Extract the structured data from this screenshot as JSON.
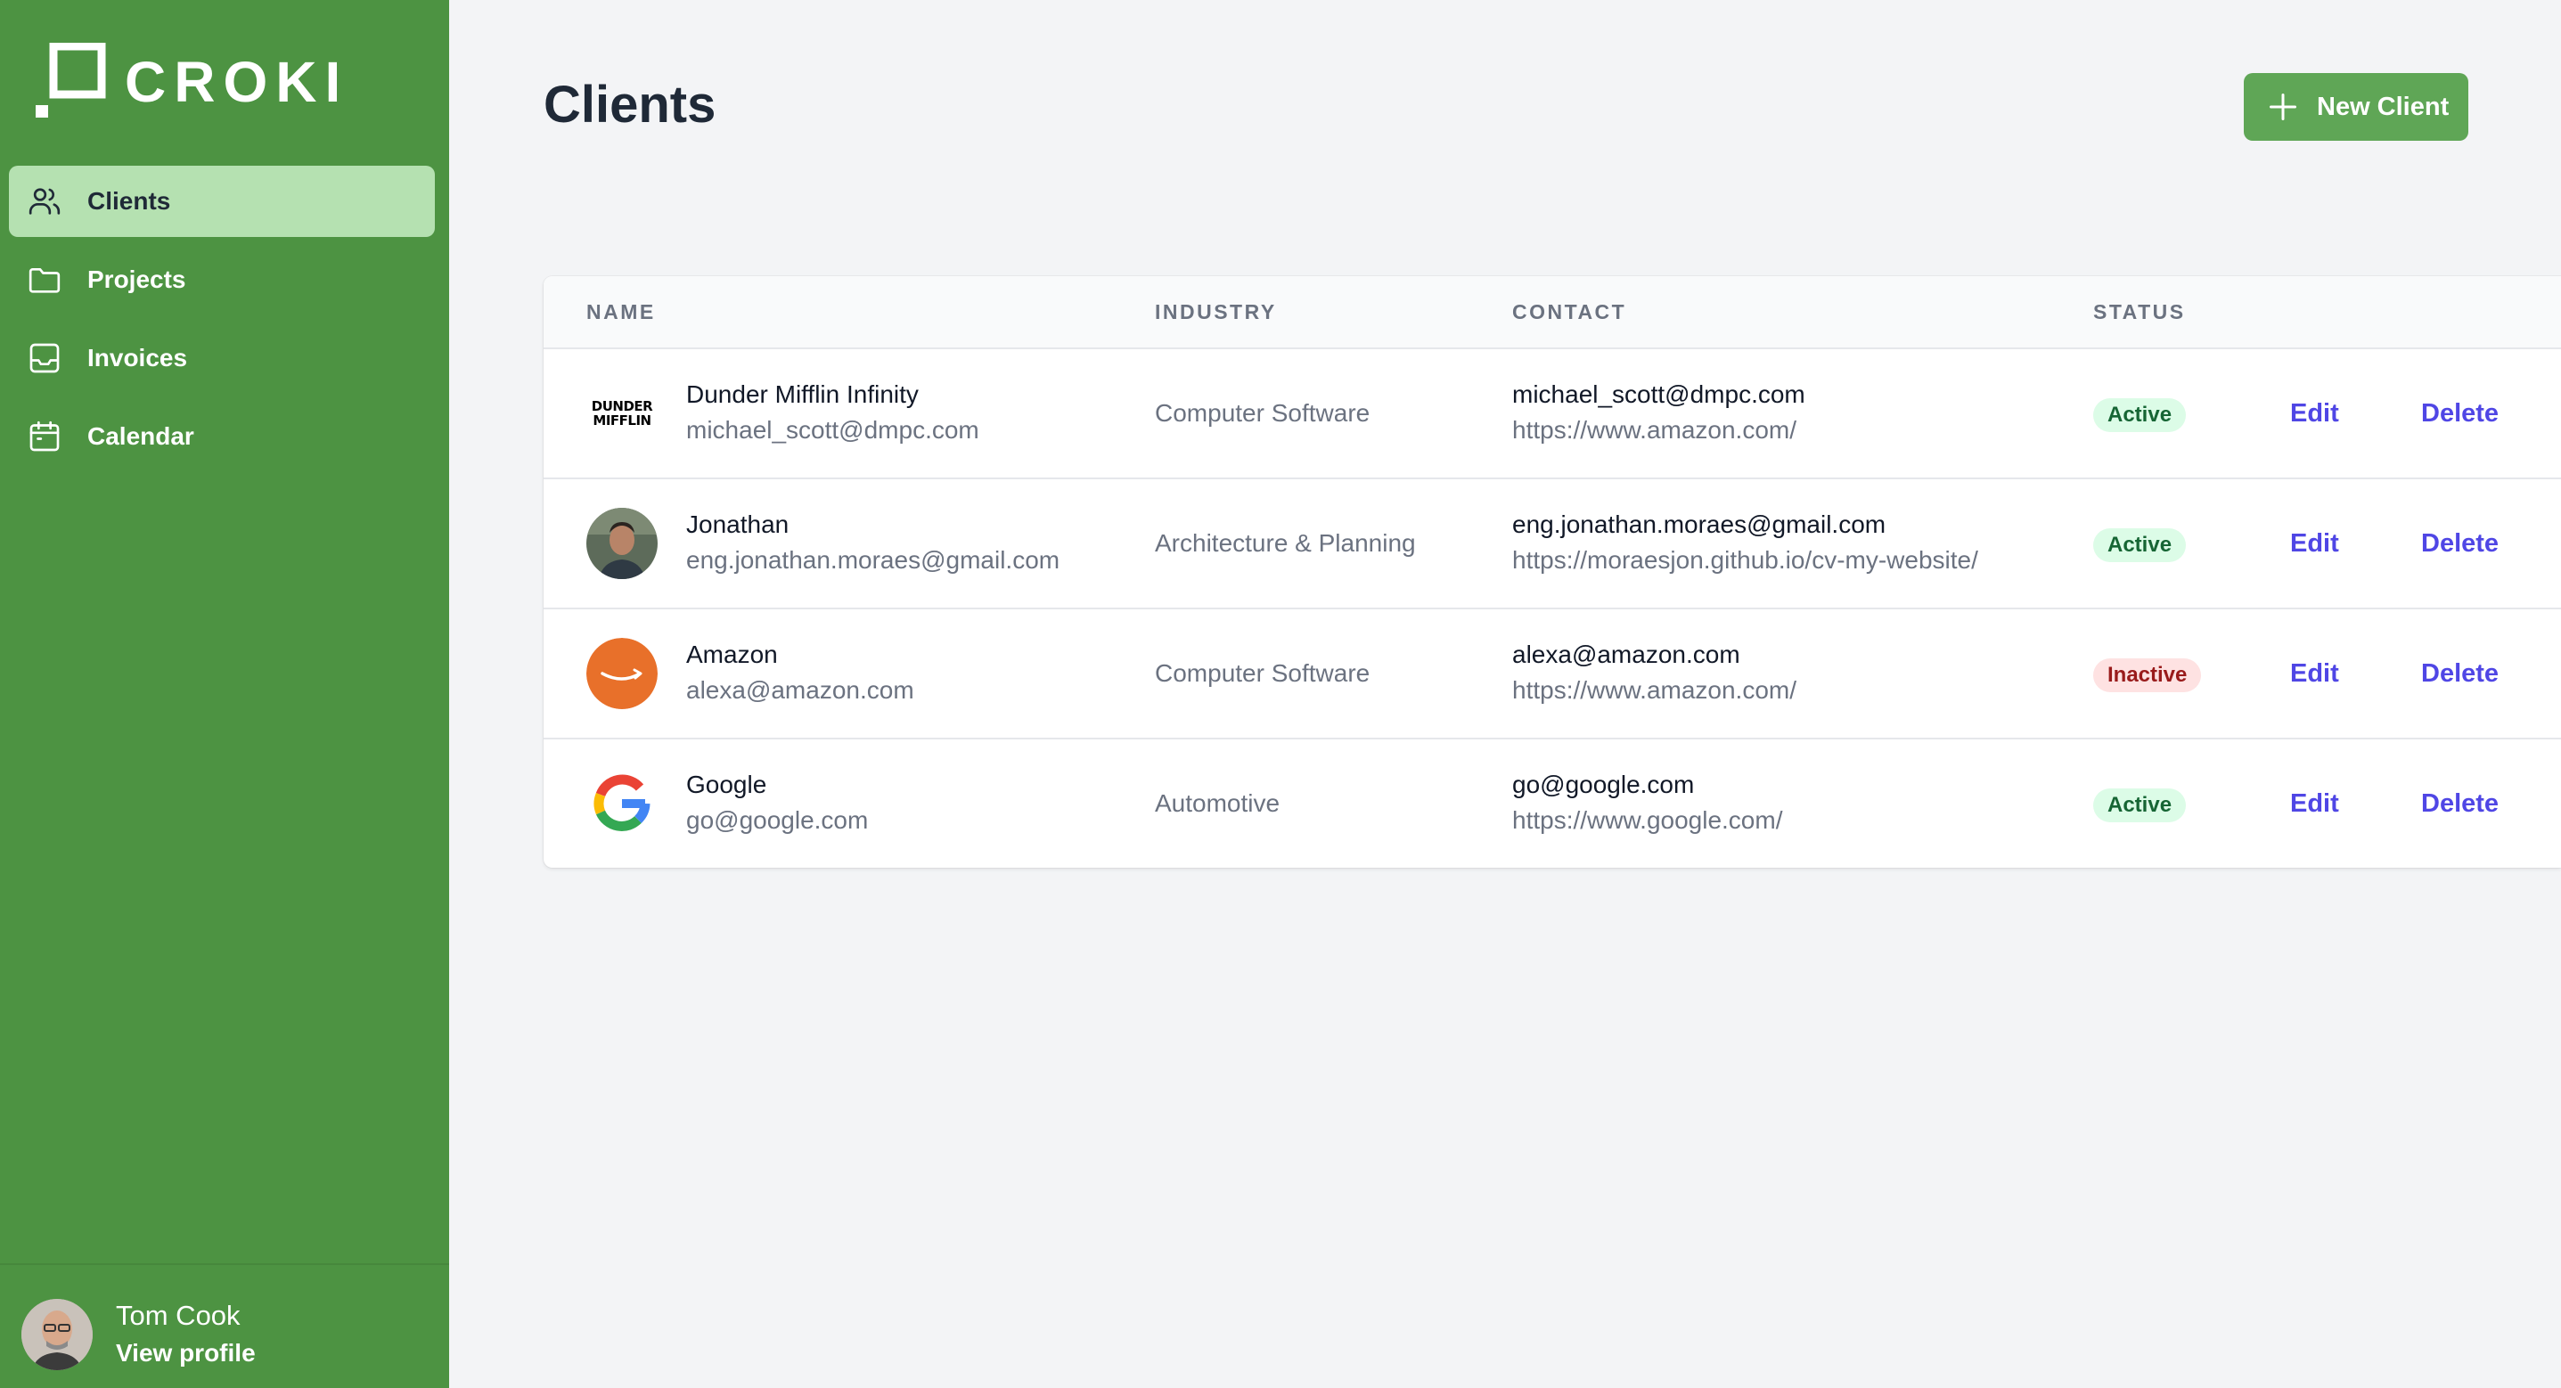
{
  "app": {
    "brand": "CROKI",
    "accent": "#4d9342",
    "active_nav_bg": "#b5e1b1",
    "button_color": "#5fa656",
    "link_color": "#4f46e5"
  },
  "sidebar": {
    "items": [
      {
        "label": "Clients",
        "icon": "users-icon",
        "active": true
      },
      {
        "label": "Projects",
        "icon": "folder-icon",
        "active": false
      },
      {
        "label": "Invoices",
        "icon": "inbox-icon",
        "active": false
      },
      {
        "label": "Calendar",
        "icon": "calendar-icon",
        "active": false
      }
    ],
    "profile": {
      "name": "Tom Cook",
      "link": "View profile"
    }
  },
  "main": {
    "title": "Clients",
    "new_button": "New Client",
    "table": {
      "headers": [
        "NAME",
        "INDUSTRY",
        "CONTACT",
        "STATUS"
      ],
      "rows": [
        {
          "name": "Dunder Mifflin Infinity",
          "email": "michael_scott@dmpc.com",
          "industry": "Computer Software",
          "contact_email": "michael_scott@dmpc.com",
          "contact_url": "https://www.amazon.com/",
          "status": "Active",
          "edit": "Edit",
          "delete": "Delete",
          "logo": [
            "DUNDER",
            "MIFFLIN"
          ]
        },
        {
          "name": "Jonathan",
          "email": "eng.jonathan.moraes@gmail.com",
          "industry": "Architecture & Planning",
          "contact_email": "eng.jonathan.moraes@gmail.com",
          "contact_url": "https://moraesjon.github.io/cv-my-website/",
          "status": "Active",
          "edit": "Edit",
          "delete": "Delete"
        },
        {
          "name": "Amazon",
          "email": "alexa@amazon.com",
          "industry": "Computer Software",
          "contact_email": "alexa@amazon.com",
          "contact_url": "https://www.amazon.com/",
          "status": "Inactive",
          "edit": "Edit",
          "delete": "Delete"
        },
        {
          "name": "Google",
          "email": "go@google.com",
          "industry": "Automotive",
          "contact_email": "go@google.com",
          "contact_url": "https://www.google.com/",
          "status": "Active",
          "edit": "Edit",
          "delete": "Delete"
        }
      ]
    }
  }
}
